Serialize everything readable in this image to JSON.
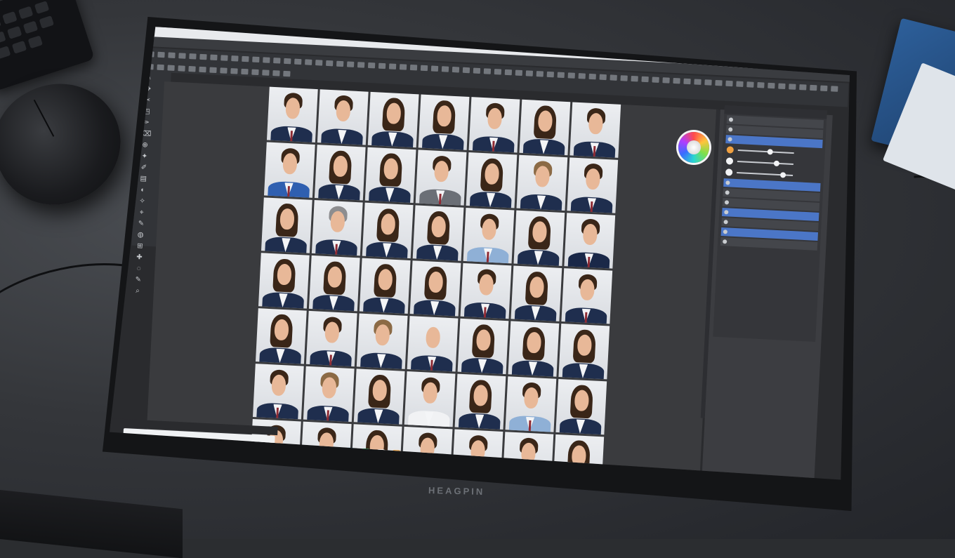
{
  "scene": {
    "monitor_brand": "HEAGPIN"
  },
  "app": {
    "menu_items": [],
    "panel": {
      "rows": [
        {
          "selected": false
        },
        {
          "selected": false
        },
        {
          "selected": true
        },
        {
          "selected": false
        },
        {
          "selected": false
        },
        {
          "selected": false
        },
        {
          "selected": true
        },
        {
          "selected": false
        },
        {
          "selected": false
        },
        {
          "selected": true
        },
        {
          "selected": false
        },
        {
          "selected": true
        },
        {
          "selected": false
        }
      ]
    },
    "colors": {
      "accent": "#4b76c7",
      "panel_bg": "#35363a",
      "canvas_bg": "#3a3b3e",
      "photo_bg": "#e2e4e8"
    },
    "icons": [
      "brush-icon",
      "move-icon",
      "lasso-icon",
      "crop-icon",
      "eyedropper-icon",
      "eraser-icon",
      "zoom-icon",
      "color-wheel-icon",
      "search-icon",
      "settings-icon"
    ]
  },
  "photo_grid": {
    "columns": 7,
    "rows": 7,
    "cells": [
      "m",
      "f",
      "f-long",
      "f-long",
      "m",
      "f-long",
      "m",
      "m-blue",
      "f-long",
      "f-long",
      "m-grey",
      "f-long",
      "f-blond",
      "m",
      "f-long",
      "m-grayhair",
      "f-long",
      "f-long",
      "m-light",
      "f-long",
      "m-navy",
      "f-long",
      "f-long",
      "f-long",
      "f-long",
      "m",
      "f-long",
      "m",
      "f-long",
      "m",
      "f-blond",
      "m-bald",
      "f-long",
      "f-long",
      "f-long",
      "m",
      "m-blond",
      "f-long",
      "m-white",
      "f-long",
      "m-light",
      "f-long",
      "m-navy",
      "m-white",
      "f-long",
      "m-white",
      "m",
      "m-light",
      "f-long"
    ]
  },
  "taskbar": {
    "app_colors": [
      "#2b6cd6",
      "#2bb0e8",
      "#e84747",
      "#3f86ea",
      "#2f7de1",
      "#1ea7e0",
      "#2fb565",
      "#ffffff",
      "#f2a13a"
    ]
  }
}
